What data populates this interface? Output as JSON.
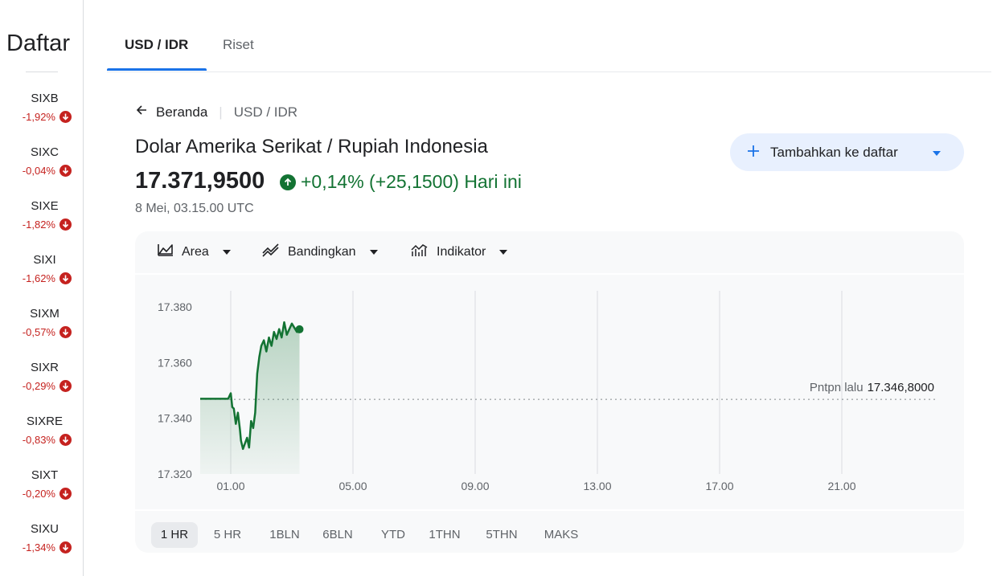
{
  "sidebar": {
    "title": "Daftar",
    "items": [
      {
        "symbol": "SIXB",
        "change": "-1,92%"
      },
      {
        "symbol": "SIXC",
        "change": "-0,04%"
      },
      {
        "symbol": "SIXE",
        "change": "-1,82%"
      },
      {
        "symbol": "SIXI",
        "change": "-1,62%"
      },
      {
        "symbol": "SIXM",
        "change": "-0,57%"
      },
      {
        "symbol": "SIXR",
        "change": "-0,29%"
      },
      {
        "symbol": "SIXRE",
        "change": "-0,83%"
      },
      {
        "symbol": "SIXT",
        "change": "-0,20%"
      },
      {
        "symbol": "SIXU",
        "change": "-1,34%"
      }
    ]
  },
  "tabs": [
    {
      "label": "USD / IDR",
      "active": true
    },
    {
      "label": "Riset",
      "active": false
    }
  ],
  "breadcrumb": {
    "back_label": "Beranda",
    "current": "USD / IDR"
  },
  "quote": {
    "title": "Dolar Amerika Serikat / Rupiah Indonesia",
    "price": "17.371,9500",
    "change": "+0,14% (+25,1500) Hari ini",
    "timestamp": "8 Mei, 03.15.00 UTC"
  },
  "add_button": {
    "label": "Tambahkan ke daftar"
  },
  "toolbar": {
    "area_label": "Area",
    "compare_label": "Bandingkan",
    "indicator_label": "Indikator"
  },
  "colors": {
    "up": "#137333",
    "down": "#c5221f",
    "accent": "#1a73e8"
  },
  "chart_data": {
    "type": "area",
    "x_ticks": [
      "01.00",
      "05.00",
      "09.00",
      "13.00",
      "17.00",
      "21.00"
    ],
    "y_ticks": [
      "17.380",
      "17.360",
      "17.340",
      "17.320"
    ],
    "ylim": [
      17320,
      17380
    ],
    "previous_close_label": "Pntpn lalu",
    "previous_close_value": "17.346,8000",
    "previous_close": 17346.8,
    "series": [
      {
        "x": [
          "00:00",
          "00:15",
          "00:30",
          "00:45",
          "00:55",
          "01:00",
          "01:03",
          "01:06",
          "01:10",
          "01:14",
          "01:18",
          "01:20",
          "01:24",
          "01:28",
          "01:32",
          "01:36",
          "01:40",
          "01:44",
          "01:48",
          "01:52",
          "01:56",
          "02:00",
          "02:05",
          "02:10",
          "02:15",
          "02:20",
          "02:25",
          "02:30",
          "02:35",
          "02:40",
          "02:45",
          "02:50",
          "03:00",
          "03:10",
          "03:15"
        ],
        "values": [
          17347.0,
          17347.0,
          17347.0,
          17347.0,
          17347.0,
          17349.0,
          17344.0,
          17343.5,
          17338.0,
          17342.0,
          17336.0,
          17332.0,
          17329.0,
          17331.0,
          17333.0,
          17329.5,
          17339.0,
          17336.5,
          17342.0,
          17356.0,
          17362.0,
          17366.0,
          17368.0,
          17364.0,
          17369.0,
          17366.0,
          17371.0,
          17368.5,
          17372.0,
          17369.0,
          17374.5,
          17370.0,
          17374.0,
          17371.0,
          17371.95
        ]
      }
    ]
  },
  "ranges": [
    "1 HR",
    "5 HR",
    "1BLN",
    "6BLN",
    "YTD",
    "1THN",
    "5THN",
    "MAKS"
  ],
  "active_range": "1 HR"
}
